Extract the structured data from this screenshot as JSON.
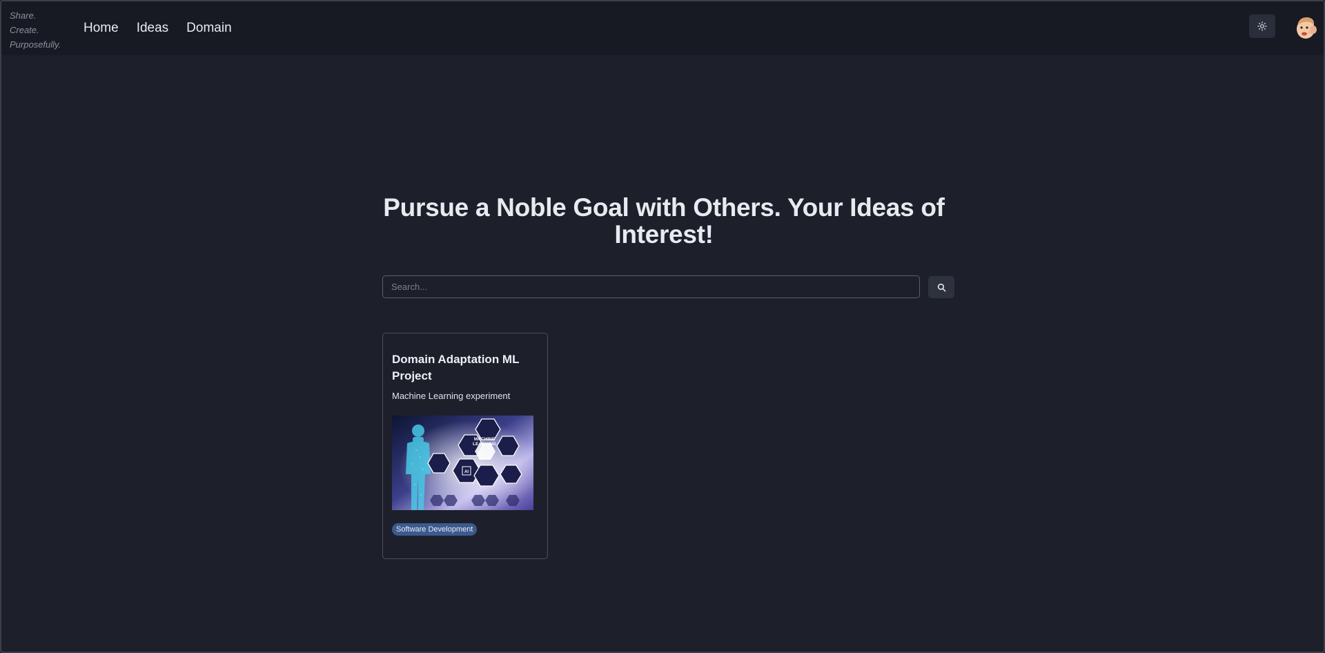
{
  "brand": {
    "line1": "Share.",
    "line2": "Create.",
    "line3": "Purposefully."
  },
  "nav": {
    "items": [
      {
        "label": "Home"
      },
      {
        "label": "Ideas"
      },
      {
        "label": "Domain"
      }
    ]
  },
  "header": {
    "theme_toggle_icon": "sun-icon",
    "avatar_icon": "avatar"
  },
  "hero": {
    "title": "Pursue a Noble Goal with Others. Your Ideas of Interest!"
  },
  "search": {
    "placeholder": "Search...",
    "value": "",
    "button_icon": "search-icon"
  },
  "cards": [
    {
      "title": "Domain Adaptation ML Project",
      "description": "Machine Learning experiment",
      "image_text_1": "MACHINE",
      "image_text_2": "LEARNING",
      "image_text_3": "AI",
      "tag": "Software Development"
    }
  ],
  "colors": {
    "background": "#1d202b",
    "navbar": "#171a23",
    "badge": "#3c5a8e"
  }
}
